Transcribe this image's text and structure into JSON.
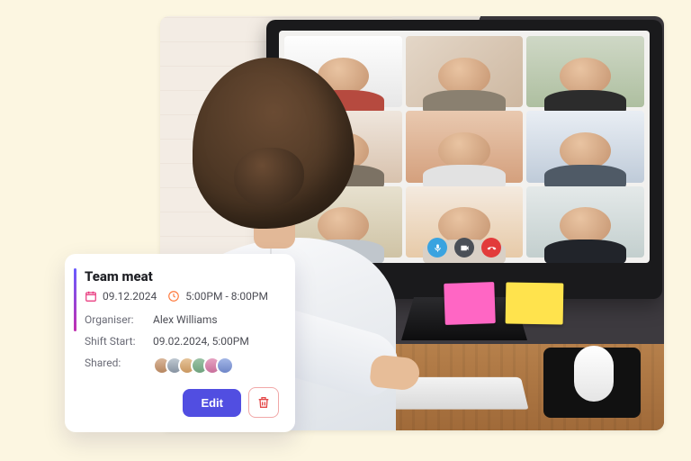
{
  "event_card": {
    "title": "Team meat",
    "date": "09.12.2024",
    "time_range": "5:00PM - 8:00PM",
    "labels": {
      "organiser": "Organiser:",
      "shift_start": "Shift Start:",
      "shared": "Shared:"
    },
    "organiser": "Alex Williams",
    "shift_start": "09.02.2024, 5:00PM",
    "shared_count": 6,
    "edit_label": "Edit"
  },
  "call_controls": {
    "mic": "mic",
    "camera": "camera",
    "end": "end-call"
  }
}
